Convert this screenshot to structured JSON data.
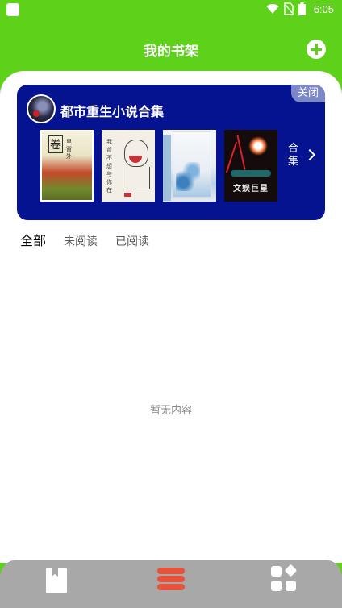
{
  "status_bar": {
    "time": "6:05",
    "icons": [
      "wifi-icon",
      "no-sim-icon",
      "battery-icon"
    ]
  },
  "header": {
    "title": "我的书架",
    "action_icon": "add-icon"
  },
  "collection_card": {
    "title": "都市重生小说合集",
    "close_label": "关闭",
    "more_label": "合集",
    "books": [
      {
        "cover_text": "卷",
        "cover_subtext": "里 窗 外"
      },
      {
        "cover_text": "我曾不想与你在"
      },
      {
        "cover_text": ""
      },
      {
        "cover_text": "文娱巨星"
      }
    ]
  },
  "tabs": [
    {
      "label": "全部",
      "active": true
    },
    {
      "label": "未阅读",
      "active": false
    },
    {
      "label": "已阅读",
      "active": false
    }
  ],
  "empty_state": {
    "text": "暂无内容"
  },
  "bottom_nav": {
    "items": [
      {
        "icon": "book-icon",
        "active": false
      },
      {
        "icon": "stack-icon",
        "active": true
      },
      {
        "icon": "apps-grid-icon",
        "active": false
      }
    ]
  },
  "colors": {
    "brand_green": "#5ed11a",
    "card_blue": "#061391",
    "active_nav": "#e6523a",
    "nav_bg": "#a8a8a8"
  }
}
